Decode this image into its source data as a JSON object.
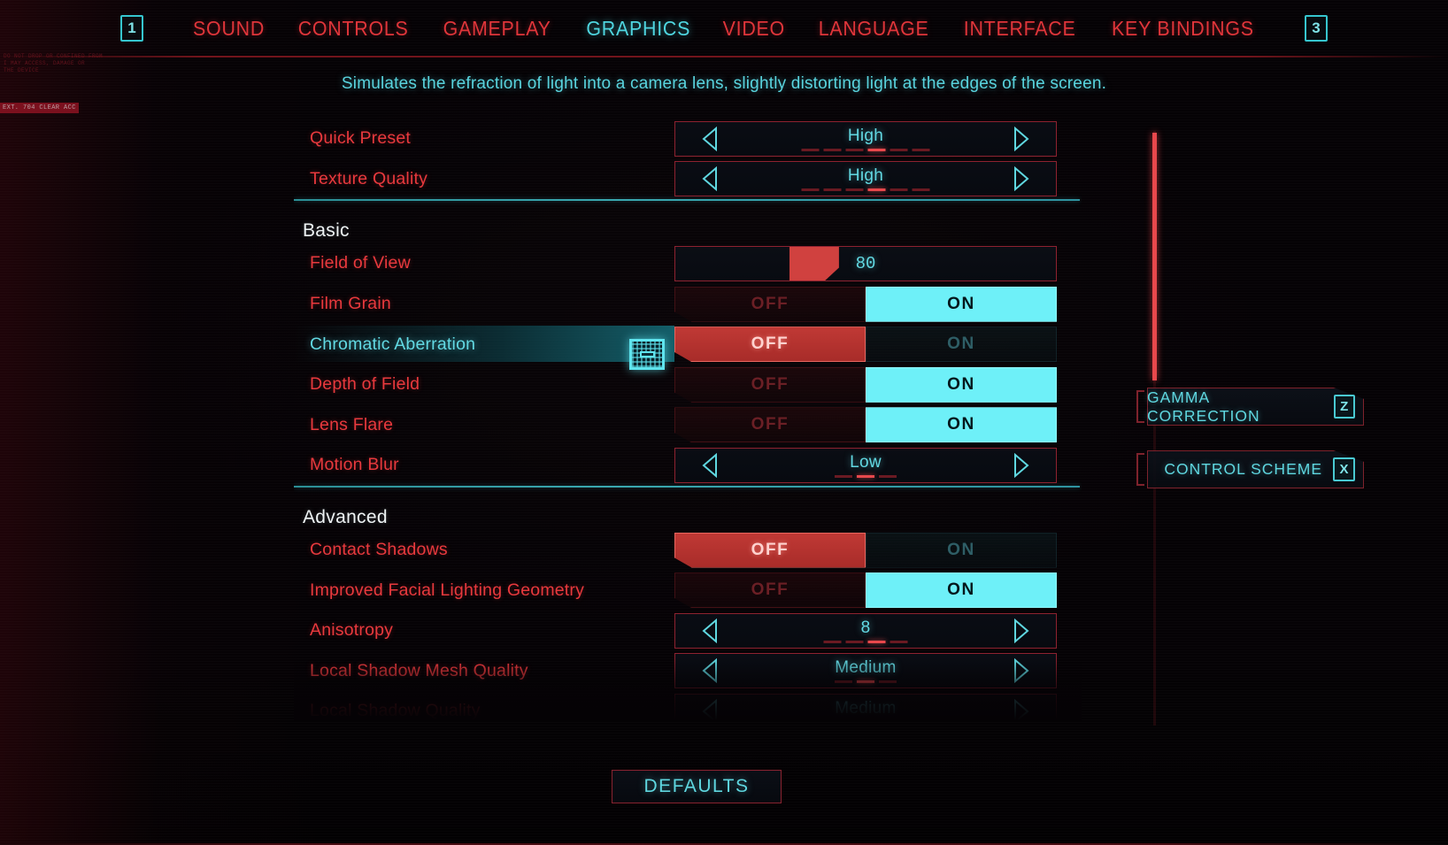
{
  "header": {
    "key_left": "1",
    "key_right": "3",
    "tabs": [
      {
        "label": "SOUND",
        "active": false
      },
      {
        "label": "CONTROLS",
        "active": false
      },
      {
        "label": "GAMEPLAY",
        "active": false
      },
      {
        "label": "GRAPHICS",
        "active": true
      },
      {
        "label": "VIDEO",
        "active": false
      },
      {
        "label": "LANGUAGE",
        "active": false
      },
      {
        "label": "INTERFACE",
        "active": false
      },
      {
        "label": "KEY BINDINGS",
        "active": false
      }
    ]
  },
  "description": "Simulates the refraction of light into a camera lens, slightly distorting light at the edges of the screen.",
  "settings": [
    {
      "kind": "stepper",
      "name": "quick-preset",
      "label": "Quick Preset",
      "value": "High",
      "segments": 6,
      "segment_index": 4,
      "selected": false
    },
    {
      "kind": "stepper",
      "name": "texture-quality",
      "label": "Texture Quality",
      "value": "High",
      "segments": 6,
      "segment_index": 4,
      "selected": false
    },
    {
      "kind": "section",
      "name": "basic",
      "title": "Basic"
    },
    {
      "kind": "slider",
      "name": "field-of-view",
      "label": "Field of View",
      "value": "80",
      "percent": 35,
      "selected": false
    },
    {
      "kind": "toggle",
      "name": "film-grain",
      "label": "Film Grain",
      "off_label": "OFF",
      "on_label": "ON",
      "state": "ON",
      "selected": false
    },
    {
      "kind": "toggle",
      "name": "chromatic-aberration",
      "label": "Chromatic Aberration",
      "off_label": "OFF",
      "on_label": "ON",
      "state": "OFF",
      "selected": true
    },
    {
      "kind": "toggle",
      "name": "depth-of-field",
      "label": "Depth of Field",
      "off_label": "OFF",
      "on_label": "ON",
      "state": "ON",
      "selected": false
    },
    {
      "kind": "toggle",
      "name": "lens-flare",
      "label": "Lens Flare",
      "off_label": "OFF",
      "on_label": "ON",
      "state": "ON",
      "selected": false
    },
    {
      "kind": "stepper",
      "name": "motion-blur",
      "label": "Motion Blur",
      "value": "Low",
      "segments": 3,
      "segment_index": 2,
      "selected": false
    },
    {
      "kind": "section",
      "name": "advanced",
      "title": "Advanced"
    },
    {
      "kind": "toggle",
      "name": "contact-shadows",
      "label": "Contact Shadows",
      "off_label": "OFF",
      "on_label": "ON",
      "state": "OFF",
      "selected": false
    },
    {
      "kind": "toggle",
      "name": "improved-facial-lighting-geometry",
      "label": "Improved Facial Lighting Geometry",
      "off_label": "OFF",
      "on_label": "ON",
      "state": "ON",
      "selected": false
    },
    {
      "kind": "stepper",
      "name": "anisotropy",
      "label": "Anisotropy",
      "value": "8",
      "segments": 4,
      "segment_index": 3,
      "selected": false
    },
    {
      "kind": "stepper",
      "name": "local-shadow-mesh-quality",
      "label": "Local Shadow Mesh Quality",
      "value": "Medium",
      "segments": 3,
      "segment_index": 2,
      "selected": false
    },
    {
      "kind": "stepper",
      "name": "local-shadow-quality",
      "label": "Local Shadow Quality",
      "value": "Medium",
      "segments": 3,
      "segment_index": 2,
      "selected": false
    }
  ],
  "hints": [
    {
      "name": "gamma-correction",
      "label": "GAMMA CORRECTION",
      "key": "Z"
    },
    {
      "name": "control-scheme",
      "label": "CONTROL SCHEME",
      "key": "X"
    }
  ],
  "footer": {
    "defaults_label": "DEFAULTS"
  },
  "decor": {
    "graffiti_1": "DO NOT DROP OR CONFINED FROM\nI MAY ACCESS, DAMAGE OR\nTHE DEVICE",
    "graffiti_2": "EXT. 704 CLEAR ACC"
  },
  "colors": {
    "accent_red": "#e8393d",
    "accent_cyan": "#5fd7e0",
    "toggle_on": "#6ef0f8",
    "toggle_off": "#c03935",
    "section_divider": "#3aa8b0",
    "background": "#050205"
  }
}
